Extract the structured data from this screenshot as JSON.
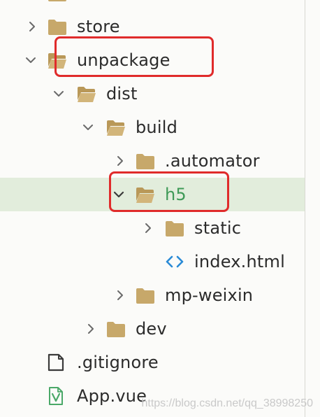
{
  "colors": {
    "folder": "#c7a86a",
    "chevron": "#6a6a6a",
    "selected_row_bg": "#e2eddc",
    "selected_label": "#3f9a57",
    "highlight_box": "#e02b2b",
    "html_icon": "#2a8bd6",
    "vue_icon": "#4aa868"
  },
  "tree": {
    "items": [
      {
        "label": "store",
        "chevron": "chevron-right-icon",
        "icon": "folder-closed-icon"
      },
      {
        "label": "unpackage",
        "chevron": "chevron-down-icon",
        "icon": "folder-open-icon"
      },
      {
        "label": "dist",
        "chevron": "chevron-down-icon",
        "icon": "folder-open-icon"
      },
      {
        "label": "build",
        "chevron": "chevron-down-icon",
        "icon": "folder-open-icon"
      },
      {
        "label": ".automator",
        "chevron": "chevron-right-icon",
        "icon": "folder-closed-icon"
      },
      {
        "label": "h5",
        "chevron": "chevron-down-icon",
        "icon": "folder-open-icon",
        "selected": true
      },
      {
        "label": "static",
        "chevron": "chevron-right-icon",
        "icon": "folder-closed-icon"
      },
      {
        "label": "index.html",
        "chevron": "",
        "icon": "html-file-icon"
      },
      {
        "label": "mp-weixin",
        "chevron": "chevron-right-icon",
        "icon": "folder-closed-icon"
      },
      {
        "label": "dev",
        "chevron": "chevron-right-icon",
        "icon": "folder-closed-icon"
      },
      {
        "label": ".gitignore",
        "chevron": "",
        "icon": "text-file-icon"
      },
      {
        "label": "App.vue",
        "chevron": "",
        "icon": "vue-file-icon"
      }
    ]
  },
  "watermark": "https://blog.csdn.net/qq_38998250"
}
